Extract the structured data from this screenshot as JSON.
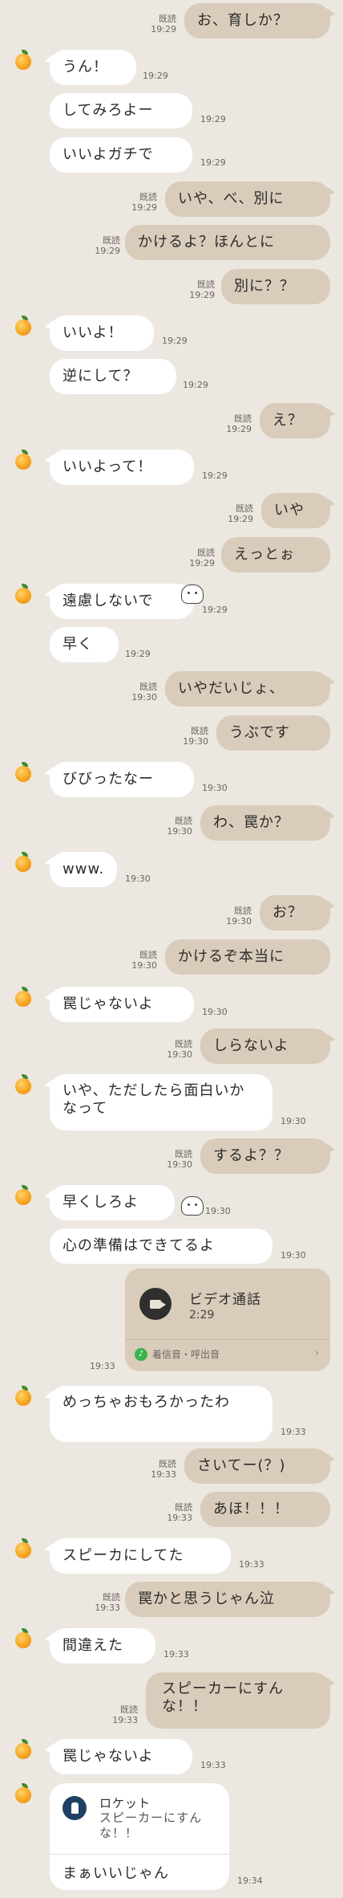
{
  "chat": {
    "read_label": "既読",
    "messages": [
      {
        "side": "out",
        "text": "お、育しか？",
        "time": "19:29",
        "read": true
      },
      {
        "side": "in",
        "text": "うん！",
        "time": "19:29",
        "avatar": true
      },
      {
        "side": "in",
        "text": "してみろよー",
        "time": "19:29"
      },
      {
        "side": "in",
        "text": "いいよガチで",
        "time": "19:29"
      },
      {
        "side": "out",
        "text": "いや、べ、別に",
        "time": "19:29",
        "read": true
      },
      {
        "side": "out",
        "text": "かけるよ？ほんとに",
        "time": "19:29",
        "read": true
      },
      {
        "side": "out",
        "text": "別に？？",
        "time": "19:29",
        "read": true
      },
      {
        "side": "in",
        "text": "いいよ！",
        "time": "19:29",
        "avatar": true
      },
      {
        "side": "in",
        "text": "逆にして？",
        "time": "19:29"
      },
      {
        "side": "out",
        "text": "え？",
        "time": "19:29",
        "read": true
      },
      {
        "side": "in",
        "text": "いいよって！",
        "time": "19:29",
        "avatar": true
      },
      {
        "side": "out",
        "text": "いや",
        "time": "19:29",
        "read": true
      },
      {
        "side": "out",
        "text": "えっとぉ",
        "time": "19:29",
        "read": true
      },
      {
        "side": "in",
        "text": "遠慮しないで",
        "time": "19:29",
        "avatar": true
      },
      {
        "side": "in",
        "text": "早く",
        "time": "19:29"
      },
      {
        "side": "out",
        "text": "いやだいじょ、",
        "time": "19:30",
        "read": true
      },
      {
        "side": "out",
        "text": "うぶです",
        "time": "19:30",
        "read": true
      },
      {
        "side": "in",
        "text": "びびったなー",
        "time": "19:30",
        "avatar": true
      },
      {
        "side": "out",
        "text": "わ、罠か？",
        "time": "19:30",
        "read": true
      },
      {
        "side": "in",
        "text": "www.",
        "time": "19:30",
        "avatar": true
      },
      {
        "side": "out",
        "text": "お？",
        "time": "19:30",
        "read": true
      },
      {
        "side": "out",
        "text": "かけるぞ本当に",
        "time": "19:30",
        "read": true
      },
      {
        "side": "in",
        "text": "罠じゃないよ",
        "time": "19:30",
        "avatar": true
      },
      {
        "side": "out",
        "text": "しらないよ",
        "time": "19:30",
        "read": true
      },
      {
        "side": "in",
        "text": "いや、ただしたら面白いかなって",
        "time": "19:30",
        "avatar": true
      },
      {
        "side": "out",
        "text": "するよ？？",
        "time": "19:30",
        "read": true
      },
      {
        "side": "in",
        "text": "早くしろよ",
        "time": "19:30",
        "avatar": true
      },
      {
        "side": "in",
        "text": "心の準備はできてるよ",
        "time": "19:30"
      },
      {
        "side": "in",
        "text": "めっちゃおもろかったわ",
        "time": "19:33",
        "avatar": true
      },
      {
        "side": "out",
        "text": "さいてー(？)",
        "time": "19:33",
        "read": true
      },
      {
        "side": "out",
        "text": "あほ！！！",
        "time": "19:33",
        "read": true
      },
      {
        "side": "in",
        "text": "スピーカにしてた",
        "time": "19:33",
        "avatar": true
      },
      {
        "side": "out",
        "text": "罠かと思うじゃん泣",
        "time": "19:33",
        "read": true
      },
      {
        "side": "in",
        "text": "間違えた",
        "time": "19:33",
        "avatar": true
      },
      {
        "side": "out",
        "text": "スピーカーにすんな！！",
        "time": "19:33",
        "read": true
      },
      {
        "side": "in",
        "text": "罠じゃないよ",
        "time": "19:33",
        "avatar": true
      }
    ]
  },
  "video_call": {
    "title": "ビデオ通話",
    "duration": "2:29",
    "footer": "着信音・呼出音",
    "time": "19:33",
    "icon": "video-camera-icon",
    "chevron": "›"
  },
  "reply": {
    "quoted_name": "ロケット",
    "quoted_text": "スピーカーにすんな！！",
    "text": "まぁいいじゃん",
    "time": "19:34"
  },
  "colors": {
    "background": "#ece7e0",
    "incoming_bubble": "#ffffff",
    "outgoing_bubble": "#d9ccba",
    "avatar": "#f7a51f"
  }
}
